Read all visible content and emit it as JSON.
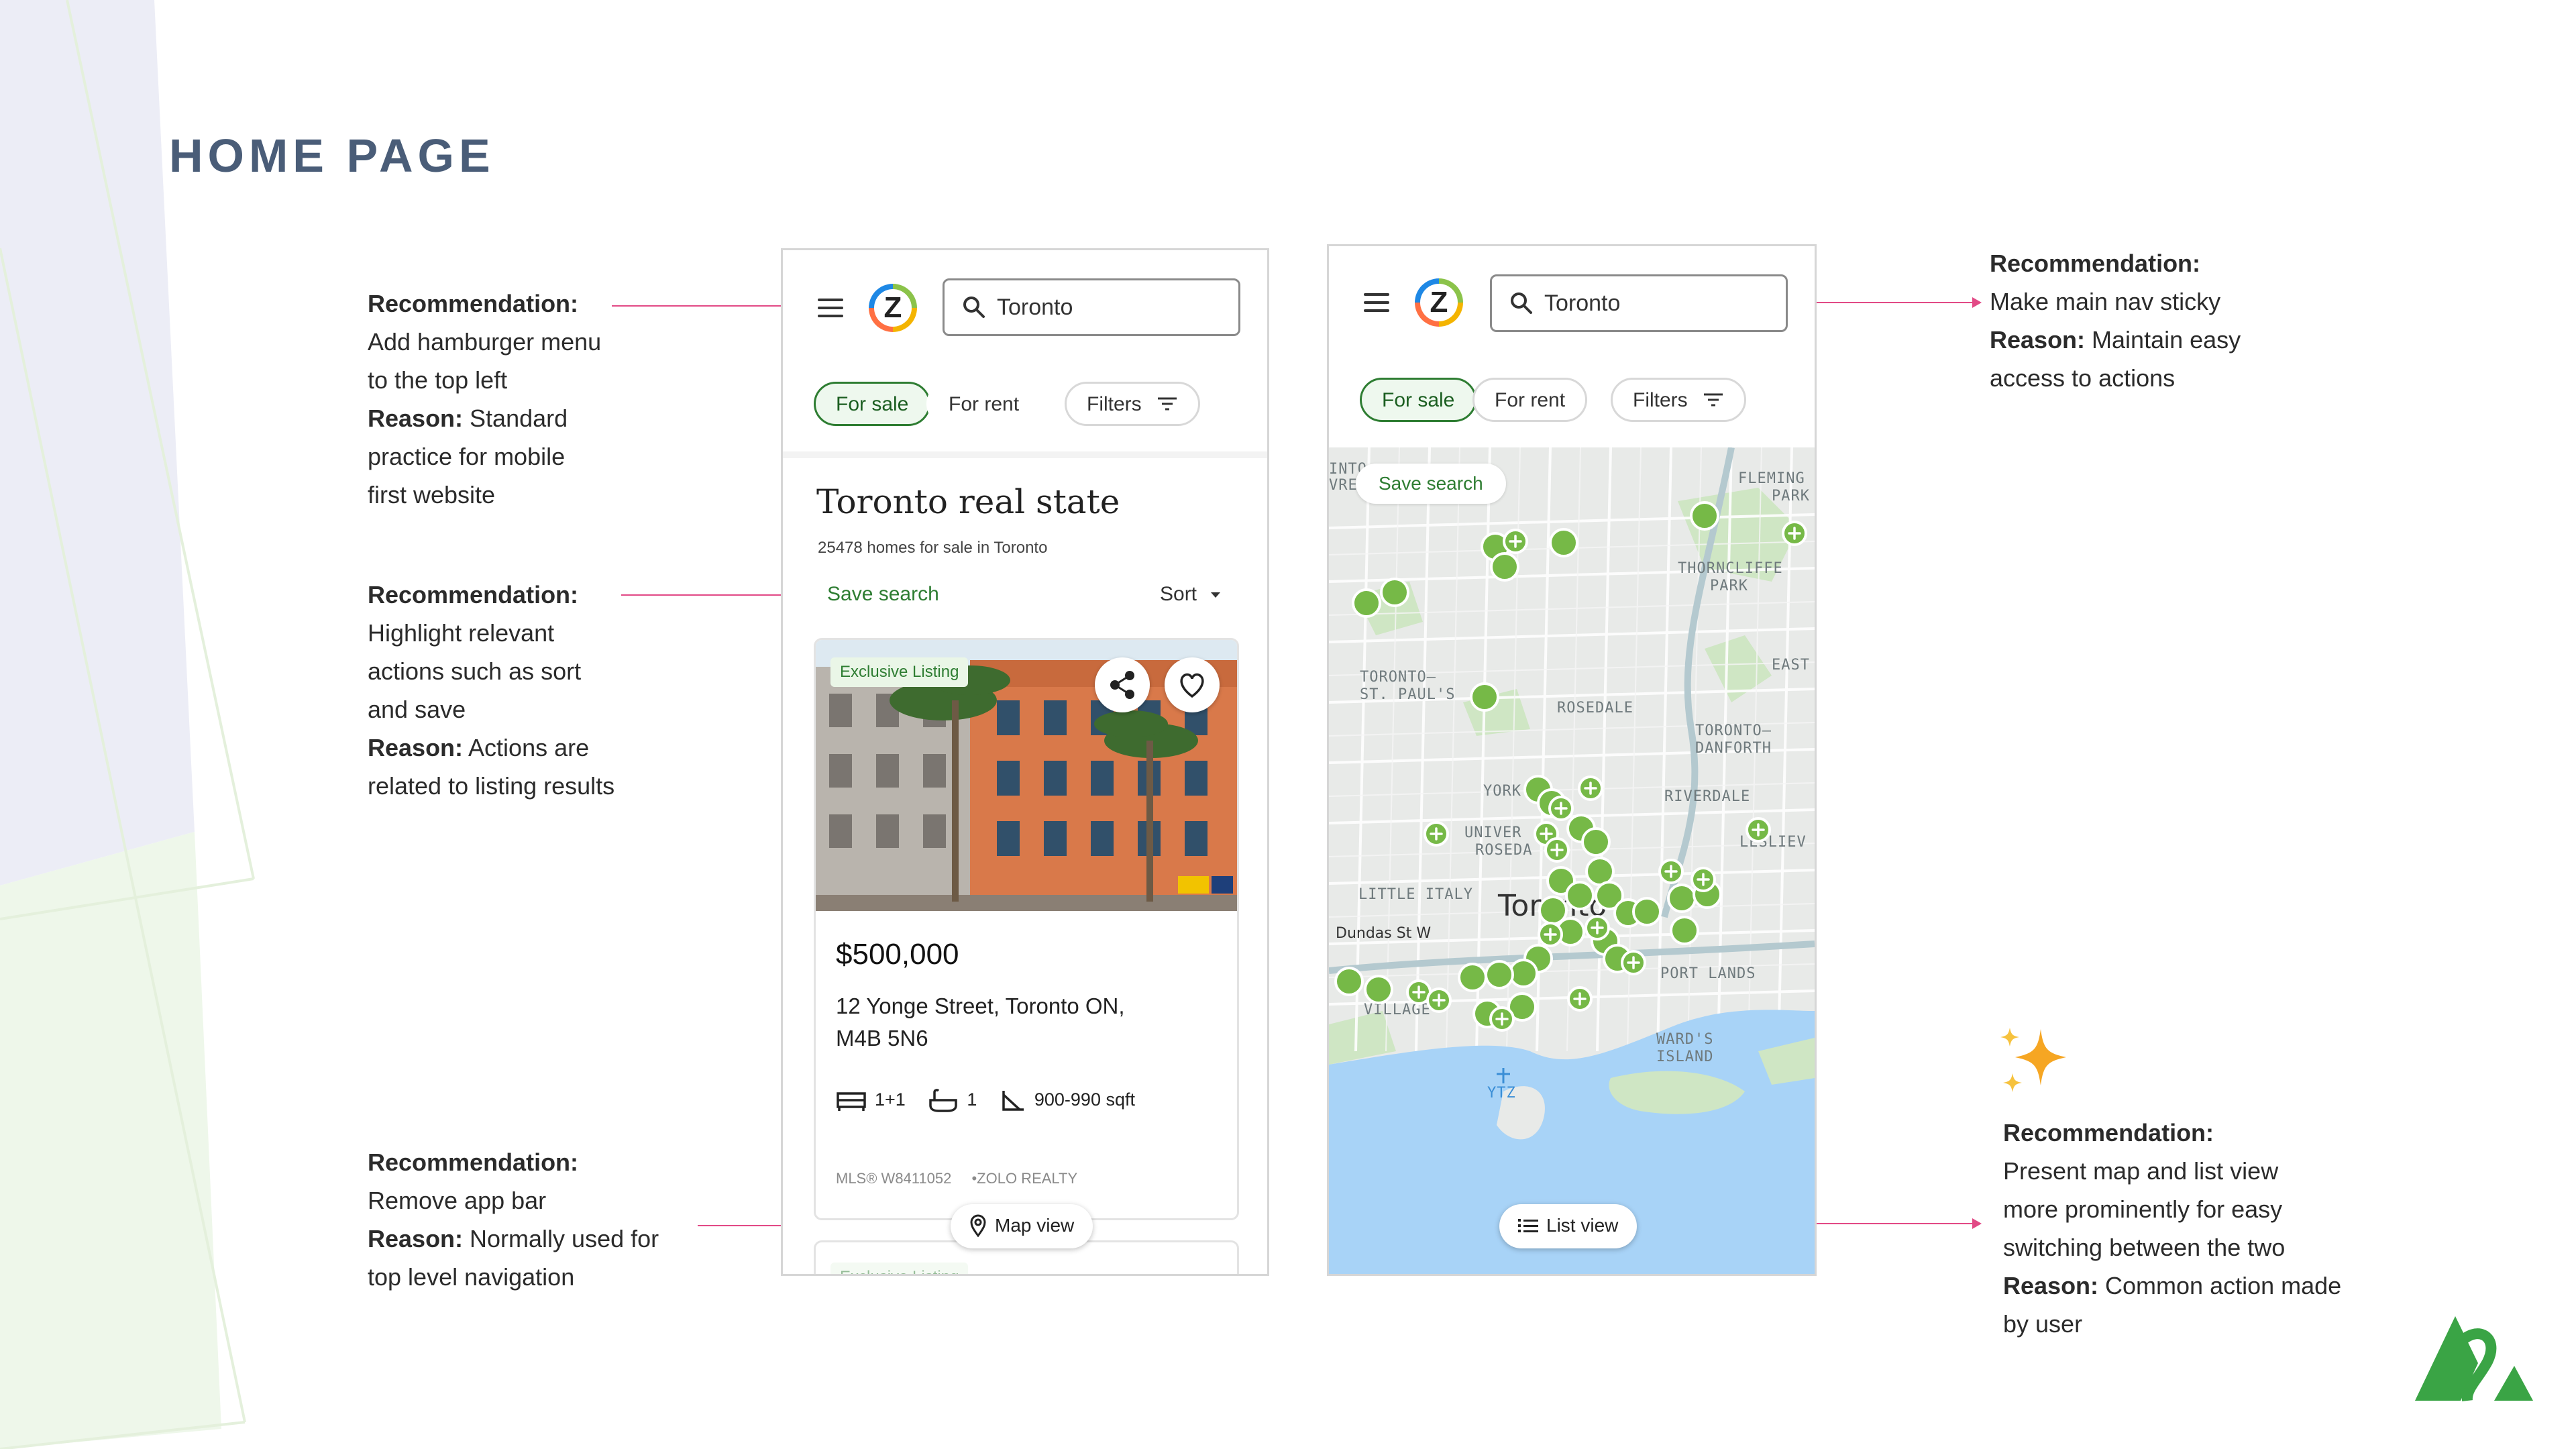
{
  "slide": {
    "title": "HOME PAGE"
  },
  "annotations": {
    "a1": {
      "rec_label": "Recommendation:",
      "rec_lines": [
        "Add hamburger menu",
        "to the top left"
      ],
      "reason_label": "Reason:",
      "reason_first": " Standard",
      "reason_lines": [
        "practice for mobile",
        "first website"
      ]
    },
    "a2": {
      "rec_label": "Recommendation:",
      "rec_lines": [
        "Highlight relevant",
        "actions such as sort",
        "and save"
      ],
      "reason_label": "Reason:",
      "reason_first": " Actions are",
      "reason_lines": [
        "related to listing results"
      ]
    },
    "a3": {
      "rec_label": "Recommendation:",
      "rec_lines": [
        "Remove app bar"
      ],
      "reason_label": "Reason:",
      "reason_first": " Normally used for",
      "reason_lines": [
        "top level navigation"
      ]
    },
    "a4": {
      "rec_label": "Recommendation:",
      "rec_lines": [
        "Make main nav sticky"
      ],
      "reason_label": "Reason:",
      "reason_first": " Maintain easy",
      "reason_lines": [
        "access to actions"
      ]
    },
    "a5": {
      "rec_label": "Recommendation:",
      "rec_lines": [
        "Present map and list view",
        "more prominently for easy",
        "switching between the two"
      ],
      "reason_label": "Reason:",
      "reason_first": " Common action made",
      "reason_lines": [
        "by user"
      ]
    }
  },
  "phone_list": {
    "logo_letter": "Z",
    "search_value": "Toronto",
    "chips": {
      "for_sale": "For sale",
      "for_rent": "For rent",
      "filters": "Filters"
    },
    "heading": "Toronto real state",
    "subheading": "25478 homes for sale in Toronto",
    "save_search": "Save search",
    "sort": "Sort",
    "listing": {
      "badge": "Exclusive Listing",
      "price": "$500,000",
      "address_line1": "12 Yonge Street, Toronto ON,",
      "address_line2": "M4B 5N6",
      "beds": "1+1",
      "baths": "1",
      "sqft": "900-990 sqft",
      "mls": "MLS® W8411052",
      "brokerage": "•ZOLO REALTY"
    },
    "next_badge": "Exclusive Listing",
    "map_view": "Map view"
  },
  "phone_map": {
    "logo_letter": "Z",
    "search_value": "Toronto",
    "chips": {
      "for_sale": "For sale",
      "for_rent": "For rent",
      "filters": "Filters"
    },
    "save_search": "Save search",
    "list_view": "List view",
    "labels": {
      "fleming_park_1": "FLEMING",
      "fleming_park_2": "PARK",
      "thorncliffe_1": "THORNCLIFFE",
      "thorncliffe_2": "PARK",
      "east": "EAST",
      "toronto_stpauls_1": "TORONTO–",
      "toronto_stpauls_2": "ST. PAUL'S",
      "rosedale": "ROSEDALE",
      "toronto_danforth_1": "TORONTO–",
      "toronto_danforth_2": "DANFORTH",
      "york": "YORK",
      "riverdale": "RIVERDALE",
      "univer": "UNIVER",
      "rosedale2": "ROSEDA",
      "leslie": "LESLIEV",
      "little_italy": "LITTLE ITALY",
      "toronto": "Toronto",
      "dundas": "Dundas St W",
      "port_lands": "PORT LANDS",
      "wards_1": "WARD'S",
      "wards_2": "ISLAND",
      "ytz": "YTZ",
      "village": "VILLAGE",
      "into": "INTO",
      "vre": "VRE"
    }
  },
  "colors": {
    "accent_green": "#2e7d32",
    "marker_green": "#76b947",
    "arrow_pink": "#e24a86",
    "title_slate": "#4a5d78",
    "water": "#a8d3f7"
  }
}
